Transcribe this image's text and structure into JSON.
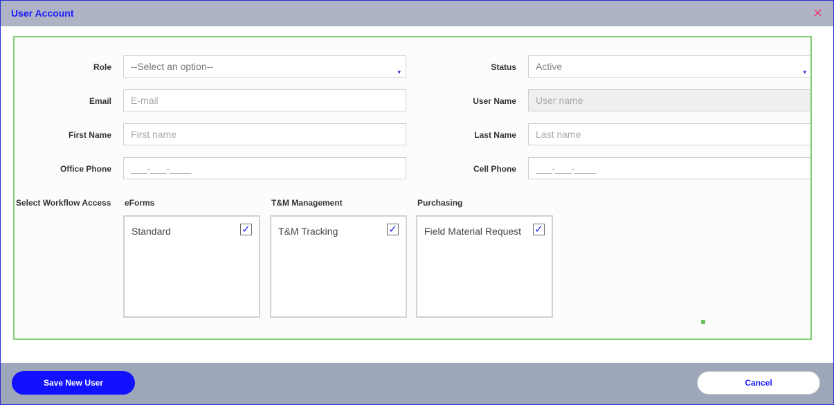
{
  "dialog": {
    "title": "User Account",
    "close_icon": "close-icon"
  },
  "form": {
    "role": {
      "label": "Role",
      "value": "--Select an option--",
      "arrow": "▾"
    },
    "status": {
      "label": "Status",
      "value": "Active",
      "arrow": "▾"
    },
    "email": {
      "label": "Email",
      "placeholder": "E-mail",
      "value": ""
    },
    "username": {
      "label": "User Name",
      "placeholder": "User name",
      "value": "",
      "disabled": true
    },
    "first_name": {
      "label": "First Name",
      "placeholder": "First name",
      "value": ""
    },
    "last_name": {
      "label": "Last Name",
      "placeholder": "Last name",
      "value": ""
    },
    "office_phone": {
      "label": "Office Phone",
      "placeholder": "___-___-____",
      "value": ""
    },
    "cell_phone": {
      "label": "Cell Phone",
      "placeholder": "___-___-____",
      "value": ""
    }
  },
  "workflow": {
    "label": "Select Workflow Access",
    "groups": [
      {
        "title": "eForms",
        "items": [
          {
            "label": "Standard",
            "checked": true
          }
        ]
      },
      {
        "title": "T&M Management",
        "items": [
          {
            "label": "T&M Tracking",
            "checked": true
          }
        ]
      },
      {
        "title": "Purchasing",
        "items": [
          {
            "label": "Field Material Request",
            "checked": true
          }
        ]
      }
    ]
  },
  "footer": {
    "save_label": "Save New User",
    "cancel_label": "Cancel"
  },
  "colors": {
    "accent": "#1111ff",
    "title_bar": "#aeb3c6",
    "footer_bar": "#9ea6ba",
    "panel_border": "#7fcf73",
    "close": "#e24a7a"
  },
  "check_glyph": "✓"
}
